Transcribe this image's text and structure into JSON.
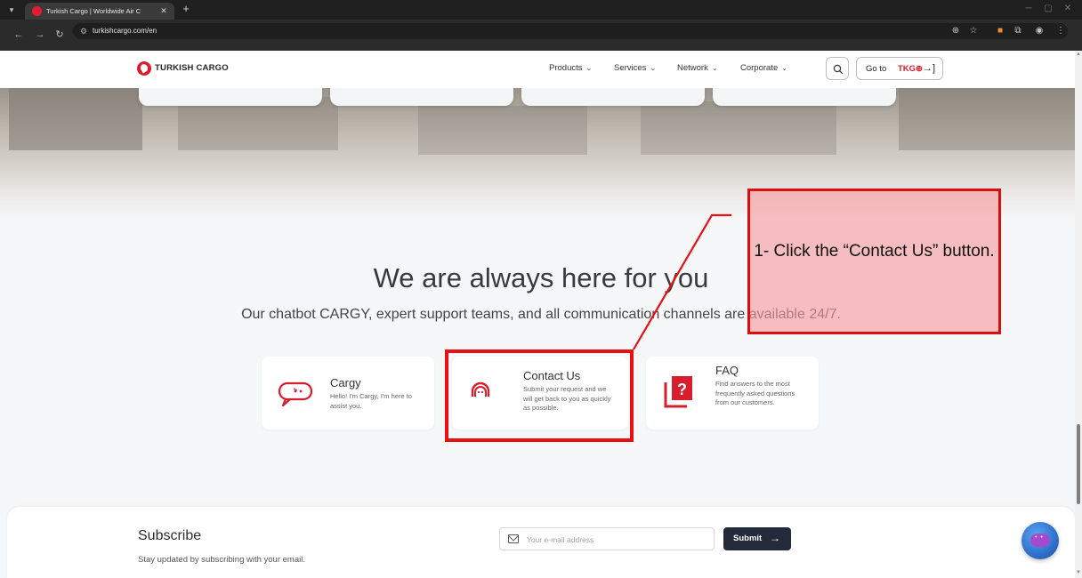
{
  "browser": {
    "tab_title": "Turkish Cargo | Worldwide Air C",
    "url": "turkishcargo.com/en"
  },
  "header": {
    "logo_text": "TURKISH CARGO",
    "nav": [
      "Products",
      "Services",
      "Network",
      "Corporate"
    ],
    "goto_prefix": "Go to",
    "goto_brand": "TKG⊕"
  },
  "main": {
    "title": "We are always here for you",
    "subtitle": "Our chatbot CARGY, expert support teams, and all communication channels are available 24/7.",
    "cards": [
      {
        "title": "Cargy",
        "desc": "Hello! I'm Cargy, I'm here to assist you."
      },
      {
        "title": "Contact Us",
        "desc": "Submit your request and we will get back to you as quickly as possible."
      },
      {
        "title": "FAQ",
        "desc": "Find answers to the most frequently asked questions from our customers."
      }
    ]
  },
  "subscribe": {
    "title": "Subscribe",
    "desc": "Stay updated by subscribing with your email.",
    "placeholder": "Your e-mail address",
    "submit": "Submit"
  },
  "annotation": {
    "text": "1- Click the “Contact Us” button."
  },
  "colors": {
    "brand_red": "#d81e2c",
    "annotation_red": "#e81010",
    "submit_bg": "#232b3a"
  }
}
